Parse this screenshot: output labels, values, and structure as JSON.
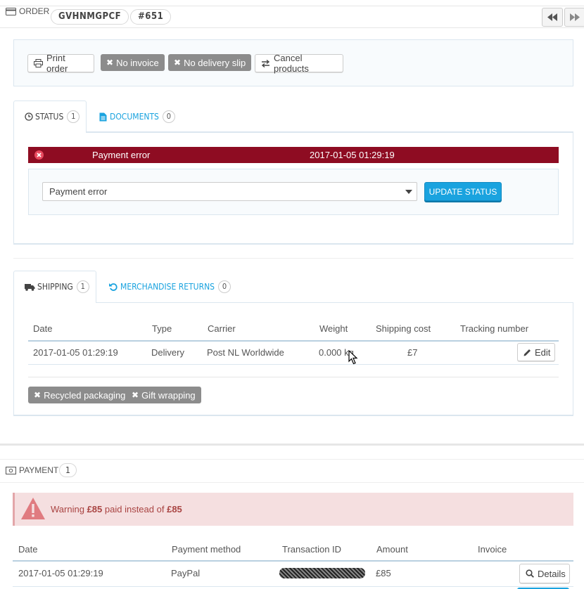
{
  "order": {
    "title": "ORDER",
    "reference": "GVHNMGPCF",
    "number": "#651"
  },
  "toolbar": {
    "print_order": "Print order",
    "no_invoice": "No invoice",
    "no_delivery_slip": "No delivery slip",
    "cancel_products": "Cancel products"
  },
  "status_tabs": {
    "status_label": "STATUS",
    "status_count": "1",
    "documents_label": "DOCUMENTS",
    "documents_count": "0"
  },
  "status_history": {
    "status": "Payment error",
    "date": "2017-01-05 01:29:19"
  },
  "status_form": {
    "selected": "Payment error",
    "update_button": "UPDATE STATUS"
  },
  "shipping_tabs": {
    "shipping_label": "SHIPPING",
    "shipping_count": "1",
    "returns_label": "MERCHANDISE RETURNS",
    "returns_count": "0"
  },
  "shipping_table": {
    "headers": [
      "Date",
      "Type",
      "Carrier",
      "Weight",
      "Shipping cost",
      "Tracking number"
    ],
    "row": {
      "date": "2017-01-05 01:29:19",
      "type": "Delivery",
      "carrier": "Post NL Worldwide",
      "weight": "0.000 kg",
      "cost": "£7",
      "edit_label": "Edit"
    }
  },
  "shipping_options": {
    "recycled": "Recycled packaging",
    "gift": "Gift wrapping"
  },
  "payment": {
    "title": "PAYMENT",
    "count": "1",
    "warning_prefix": "Warning",
    "warning_paid": "£85",
    "warning_middle": "paid instead of",
    "warning_expected": "£85",
    "headers": [
      "Date",
      "Payment method",
      "Transaction ID",
      "Amount",
      "Invoice"
    ],
    "row": {
      "date": "2017-01-05 01:29:19",
      "method": "PayPal",
      "amount": "£85",
      "details_label": "Details"
    }
  },
  "colors": {
    "primary": "#1aa3df",
    "error_bar": "#8e0c22",
    "alert_bg": "#f5dfe0",
    "alert_text": "#a94442"
  }
}
